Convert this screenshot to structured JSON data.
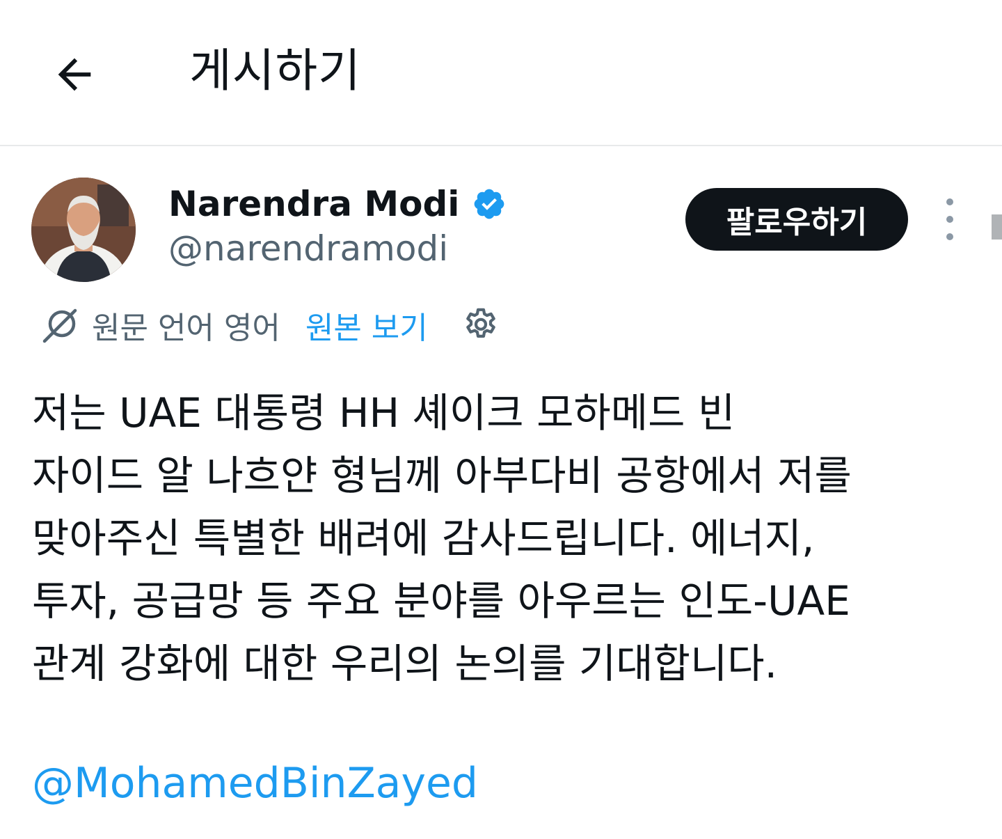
{
  "header": {
    "back_icon": "arrow-left-icon",
    "title": "게시하기"
  },
  "author": {
    "name": "Narendra Modi",
    "handle": "@narendramodi",
    "verified_icon": "verified-badge-icon",
    "verified_color": "#1d9bf0"
  },
  "actions": {
    "follow_label": "팔로우하기",
    "more_icon": "more-vertical-icon"
  },
  "translation": {
    "icon": "translate-icon",
    "source_text": "원문 언어 영어",
    "view_original_label": "원본 보기",
    "settings_icon": "gear-icon"
  },
  "tweet": {
    "lines": [
      "저는 UAE 대통령 HH 셰이크 모하메드 빈",
      "자이드 알 나흐얀 형님께 아부다비 공항에서 저를",
      "맞아주신 특별한 배려에 감사드립니다. 에너지,",
      "투자, 공급망 등 주요 분야를 아우르는 인도-UAE",
      "관계 강화에 대한 우리의 논의를 기대합니다."
    ],
    "mention": "@MohamedBinZayed"
  },
  "colors": {
    "text": "#0f1419",
    "secondary": "#536471",
    "link": "#1d9bf0",
    "follow_bg": "#0f1419"
  }
}
